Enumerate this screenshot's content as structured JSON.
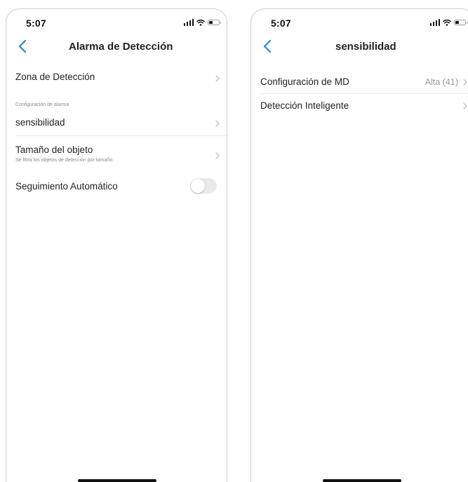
{
  "accent_color": "#3d8fd6",
  "left_screen": {
    "status": {
      "time": "5:07"
    },
    "nav": {
      "back_icon": "chevron-left-icon",
      "title": "Alarma de Detección"
    },
    "detection_zone": {
      "label": "Zona de Detección"
    },
    "alarm_section": {
      "header": "Configuración de alarma"
    },
    "sensitivity": {
      "label": "sensibilidad"
    },
    "object_size": {
      "label": "Tamaño del objeto",
      "description": "Se filtra los objetos de detección por tamaño."
    },
    "auto_tracking": {
      "label": "Seguimiento Automático",
      "enabled": false
    }
  },
  "right_screen": {
    "status": {
      "time": "5:07"
    },
    "nav": {
      "back_icon": "chevron-left-icon",
      "title": "sensibilidad"
    },
    "md_config": {
      "label": "Configuración de MD",
      "value": "Alta (41)"
    },
    "smart_detection": {
      "label": "Detección Inteligente"
    }
  }
}
